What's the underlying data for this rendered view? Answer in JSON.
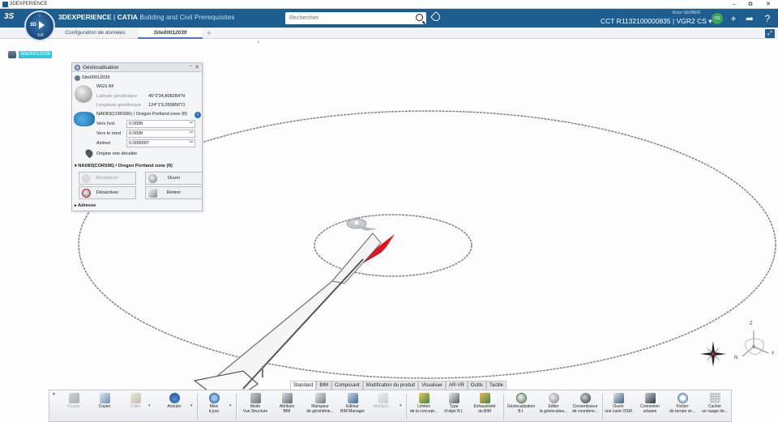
{
  "window": {
    "title": "3DEXPERIENCE",
    "controls": [
      "–",
      "⧉",
      "✕"
    ]
  },
  "topbar": {
    "ds_logo": "3S",
    "compass": {
      "label": "3D",
      "version": "V,R"
    },
    "brand_bold": "3DEXPERIENCE",
    "brand_sep": " | ",
    "brand_app": "CATIA",
    "brand_product": " Building and Civil Prerequisites",
    "search_placeholder": "Rechercher",
    "user_name": "Victor GERBER",
    "context": "CCT R1132100000835 | VGR2 CS",
    "avatar_initials": "VG"
  },
  "tabs": {
    "items": [
      {
        "label": "Configuration de données"
      },
      {
        "label": "Site00012039"
      }
    ],
    "add": "+"
  },
  "tree": {
    "root_label": "Site00012039"
  },
  "geolocation": {
    "title": "Géolocalisation",
    "site": "Site00012039",
    "system1": "WGS 84",
    "lat_label": "Latitude géodésique",
    "lat_value": "45°2'34,808284\"N",
    "lon_label": "Longitude géodésique",
    "lon_value": "124°1'9,269850\"O",
    "projection": "NAD83(CORS96) / Oregon Portland zone (ft)",
    "east_label": "Vers l'est",
    "east_value": "0,000ft",
    "north_label": "Vers le nord",
    "north_value": "0,000ft",
    "azimuth_label": "Azimut",
    "azimuth_value": "0,000000°",
    "origin": "Origine non décalée",
    "section_title": "NAD83(CORS96) / Oregon Portland zone (ft)",
    "btn_replace": "Remplacer",
    "btn_open": "Ouvrir",
    "btn_deactivate": "Désactiver",
    "btn_remove": "Retirer",
    "address": "Adresse"
  },
  "bottom_tabs": [
    "Standard",
    "BIM",
    "Composant",
    "Modification du produit",
    "Visualiser",
    "AR-VR",
    "Outils",
    "Tactile"
  ],
  "toolbar": {
    "copy_cut": "Couper",
    "copy": "Copier",
    "paste": "Coller",
    "undo": "Annuler",
    "update": [
      "Mise",
      "à jour"
    ],
    "mode": [
      "Mode",
      "Vue Structure"
    ],
    "bim_attrs": [
      "Attributs",
      "BIM"
    ],
    "geom_marker": [
      "Marqueur",
      "de géométrie..."
    ],
    "bim_manager": [
      "Editeur",
      "BIM Manager"
    ],
    "manipulate": [
      "Manipul..."
    ],
    "limits": [
      "Limites",
      "de la concept..."
    ],
    "bl_type": [
      "Type",
      "d'objet B.I."
    ],
    "bim_check": [
      "Exhaustivité",
      "du BIM"
    ],
    "geoloc": [
      "Géolocalisation",
      "B.I."
    ],
    "edit_geoloc": [
      "Editer",
      "la géolocalisa..."
    ],
    "coord_conv": [
      "Convertisseur",
      "de coordonn..."
    ],
    "osm": [
      "Ouvrir",
      "une carte OSM"
    ],
    "urban": [
      "Connexion",
      "urbaine"
    ],
    "terrain": [
      "Fichier",
      "de terrain vir..."
    ],
    "hide_cloud": [
      "Cacher",
      "un nuage de..."
    ]
  },
  "triad": {
    "z": "Z",
    "n": "N",
    "x": "x"
  },
  "colors": {
    "topbar": "#1d5d8f",
    "selection": "#29c9e0",
    "compass_red": "#e0141e"
  }
}
